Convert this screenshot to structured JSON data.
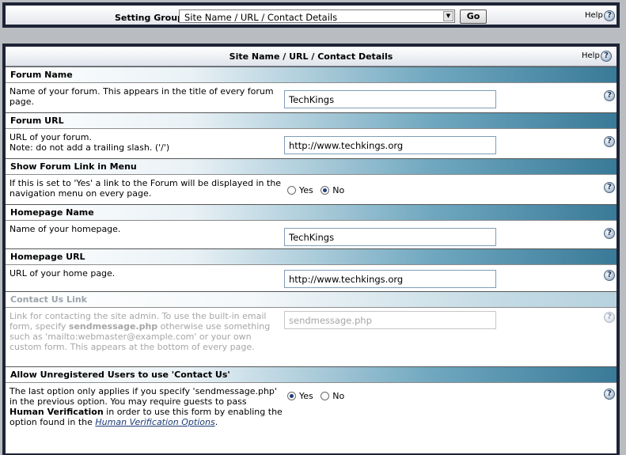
{
  "header": {
    "setting_group_label": "Setting Group",
    "setting_group_value": "Site Name / URL / Contact Details",
    "go_label": "Go",
    "help_label": "Help",
    "help_glyph": "?"
  },
  "panel": {
    "title": "Site Name / URL / Contact Details",
    "help_label": "Help",
    "help_glyph": "?"
  },
  "settings": [
    {
      "title": "Forum Name",
      "desc": "Name of your forum. This appears in the title of every forum page.",
      "value": "TechKings"
    },
    {
      "title": "Forum URL",
      "desc_line1": "URL of your forum.",
      "desc_line2": "Note: do not add a trailing slash. ('/')",
      "value": "http://www.techkings.org"
    },
    {
      "title": "Show Forum Link in Menu",
      "desc": "If this is set to 'Yes' a link to the Forum will be displayed in the navigation menu on every page.",
      "yes": "Yes",
      "no": "No",
      "selected": "No"
    },
    {
      "title": "Homepage Name",
      "desc": "Name of your homepage.",
      "value": "TechKings"
    },
    {
      "title": "Homepage URL",
      "desc": "URL of your home page.",
      "value": "http://www.techkings.org"
    },
    {
      "title": "Contact Us Link",
      "desc_a": "Link for contacting the site admin. To use the built-in email form, specify ",
      "desc_b": "sendmessage.php",
      "desc_c": " otherwise use something such as 'mailto:webmaster@example.com' or your own custom form. This appears at the bottom of every page.",
      "value": "sendmessage.php",
      "disabled": true
    },
    {
      "title": "Allow Unregistered Users to use 'Contact Us'",
      "desc_a": "The last option only applies if you specify 'sendmessage.php' in the previous option. You may require guests to pass ",
      "desc_b": "Human Verification",
      "desc_c": " in order to use this form by enabling the option found in the ",
      "desc_link": "Human Verification Options",
      "desc_d": ".",
      "yes": "Yes",
      "no": "No",
      "selected": "Yes"
    }
  ],
  "colors": {
    "frame": "#1d2436",
    "section_header_dark": "#397a98",
    "section_header_light": "#ffffff",
    "radio_selected": "#1f3c7a"
  },
  "icons": [
    "help-icon",
    "dropdown-arrow-icon",
    "radio-icon"
  ]
}
